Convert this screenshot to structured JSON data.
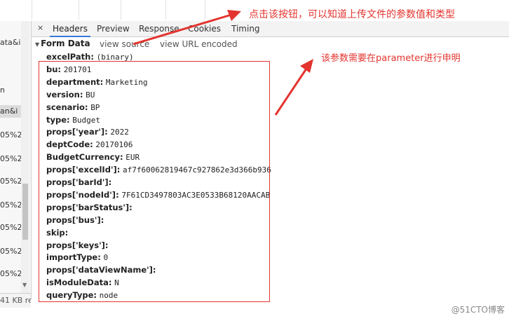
{
  "tabs": {
    "close_glyph": "×",
    "items": [
      {
        "label": "Headers",
        "active": true
      },
      {
        "label": "Preview",
        "active": false
      },
      {
        "label": "Response",
        "active": false
      },
      {
        "label": "Cookies",
        "active": false
      },
      {
        "label": "Timing",
        "active": false
      }
    ]
  },
  "left_list": {
    "rows": [
      "ata&i",
      "",
      "n",
      "an&i",
      "05%2",
      "05%2",
      "05%2",
      "05%2",
      "05%2",
      "05%2",
      "05%2"
    ],
    "status": "41 KB re"
  },
  "form": {
    "title": "Form Data",
    "view_source": "view source",
    "view_url_encoded": "view URL encoded",
    "fields": [
      {
        "k": "excelPath:",
        "v": "(binary)"
      },
      {
        "k": "bu:",
        "v": "201701"
      },
      {
        "k": "department:",
        "v": "Marketing"
      },
      {
        "k": "version:",
        "v": "BU"
      },
      {
        "k": "scenario:",
        "v": "BP"
      },
      {
        "k": "type:",
        "v": "Budget"
      },
      {
        "k": "props['year']:",
        "v": "2022"
      },
      {
        "k": "deptCode:",
        "v": "20170106"
      },
      {
        "k": "BudgetCurrency:",
        "v": "EUR"
      },
      {
        "k": "props['excelId']:",
        "v": "af7f60062819467c927862e3d366b936"
      },
      {
        "k": "props['barId']:",
        "v": ""
      },
      {
        "k": "props['nodeId']:",
        "v": "7F61CD3497803AC3E0533B68120AACAB"
      },
      {
        "k": "props['barStatus']:",
        "v": ""
      },
      {
        "k": "props['bus']:",
        "v": ""
      },
      {
        "k": "skip:",
        "v": ""
      },
      {
        "k": "props['keys']:",
        "v": ""
      },
      {
        "k": "importType:",
        "v": "0"
      },
      {
        "k": "props['dataViewName']:",
        "v": ""
      },
      {
        "k": "isModuleData:",
        "v": "N"
      },
      {
        "k": "queryType:",
        "v": "node"
      }
    ]
  },
  "annotations": {
    "note1": "点击该按钮，可以知道上传文件的参数值和类型",
    "note2": "该参数需要在parameter进行申明",
    "color": "#e3342f"
  },
  "watermark": "@51CTO博客"
}
